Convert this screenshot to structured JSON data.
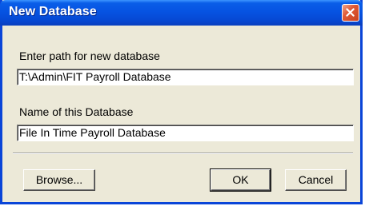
{
  "window": {
    "title": "New Database"
  },
  "form": {
    "path_label": "Enter path for new database",
    "path_value": "T:\\Admin\\FIT Payroll Database",
    "name_label": "Name of this Database",
    "name_value": "File In Time Payroll Database"
  },
  "buttons": {
    "browse": "Browse...",
    "ok": "OK",
    "cancel": "Cancel"
  },
  "icons": {
    "close": "close-icon"
  },
  "colors": {
    "titlebar": "#0653e2",
    "close_button": "#e05a35",
    "dialog_bg": "#ece9d8"
  }
}
